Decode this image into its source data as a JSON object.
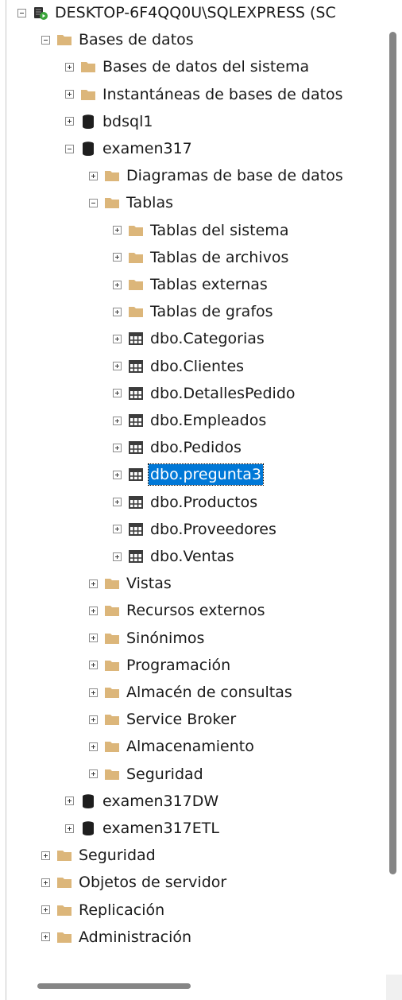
{
  "server": {
    "label": "DESKTOP-6F4QQ0U\\SQLEXPRESS (SC",
    "icon": "server-running-icon",
    "expanded": true
  },
  "tree": [
    {
      "name": "node-bases-de-datos",
      "label": "Bases de datos",
      "level": 1,
      "icon": "folder-icon",
      "expanded": true
    },
    {
      "name": "node-bases-de-datos-del-sistema",
      "label": "Bases de datos del sistema",
      "level": 2,
      "icon": "folder-icon",
      "expanded": false
    },
    {
      "name": "node-instantaneas",
      "label": "Instantáneas de bases de datos",
      "level": 2,
      "icon": "folder-icon",
      "expanded": false
    },
    {
      "name": "node-bdsql1",
      "label": "bdsql1",
      "level": 2,
      "icon": "database-icon",
      "expanded": false
    },
    {
      "name": "node-examen317",
      "label": "examen317",
      "level": 2,
      "icon": "database-icon",
      "expanded": true
    },
    {
      "name": "node-diagramas",
      "label": "Diagramas de base de datos",
      "level": 3,
      "icon": "folder-icon",
      "expanded": false
    },
    {
      "name": "node-tablas",
      "label": "Tablas",
      "level": 3,
      "icon": "folder-icon",
      "expanded": true
    },
    {
      "name": "node-tablas-del-sistema",
      "label": "Tablas del sistema",
      "level": 4,
      "icon": "folder-icon",
      "expanded": false
    },
    {
      "name": "node-tablas-de-archivos",
      "label": "Tablas de archivos",
      "level": 4,
      "icon": "folder-icon",
      "expanded": false
    },
    {
      "name": "node-tablas-externas",
      "label": "Tablas externas",
      "level": 4,
      "icon": "folder-icon",
      "expanded": false
    },
    {
      "name": "node-tablas-de-grafos",
      "label": "Tablas de grafos",
      "level": 4,
      "icon": "folder-icon",
      "expanded": false
    },
    {
      "name": "node-dbo-categorias",
      "label": "dbo.Categorias",
      "level": 4,
      "icon": "table-icon",
      "expanded": false
    },
    {
      "name": "node-dbo-clientes",
      "label": "dbo.Clientes",
      "level": 4,
      "icon": "table-icon",
      "expanded": false
    },
    {
      "name": "node-dbo-detallespedido",
      "label": "dbo.DetallesPedido",
      "level": 4,
      "icon": "table-icon",
      "expanded": false
    },
    {
      "name": "node-dbo-empleados",
      "label": "dbo.Empleados",
      "level": 4,
      "icon": "table-icon",
      "expanded": false
    },
    {
      "name": "node-dbo-pedidos",
      "label": "dbo.Pedidos",
      "level": 4,
      "icon": "table-icon",
      "expanded": false
    },
    {
      "name": "node-dbo-pregunta3",
      "label": "dbo.pregunta3",
      "level": 4,
      "icon": "table-icon",
      "expanded": false,
      "selected": true
    },
    {
      "name": "node-dbo-productos",
      "label": "dbo.Productos",
      "level": 4,
      "icon": "table-icon",
      "expanded": false
    },
    {
      "name": "node-dbo-proveedores",
      "label": "dbo.Proveedores",
      "level": 4,
      "icon": "table-icon",
      "expanded": false
    },
    {
      "name": "node-dbo-ventas",
      "label": "dbo.Ventas",
      "level": 4,
      "icon": "table-icon",
      "expanded": false
    },
    {
      "name": "node-vistas",
      "label": "Vistas",
      "level": 3,
      "icon": "folder-icon",
      "expanded": false
    },
    {
      "name": "node-recursos-externos",
      "label": "Recursos externos",
      "level": 3,
      "icon": "folder-icon",
      "expanded": false
    },
    {
      "name": "node-sinonimos",
      "label": "Sinónimos",
      "level": 3,
      "icon": "folder-icon",
      "expanded": false
    },
    {
      "name": "node-programacion",
      "label": "Programación",
      "level": 3,
      "icon": "folder-icon",
      "expanded": false
    },
    {
      "name": "node-almacen-de-consultas",
      "label": "Almacén de consultas",
      "level": 3,
      "icon": "folder-icon",
      "expanded": false
    },
    {
      "name": "node-service-broker",
      "label": "Service Broker",
      "level": 3,
      "icon": "folder-icon",
      "expanded": false
    },
    {
      "name": "node-almacenamiento",
      "label": "Almacenamiento",
      "level": 3,
      "icon": "folder-icon",
      "expanded": false
    },
    {
      "name": "node-seguridad-db",
      "label": "Seguridad",
      "level": 3,
      "icon": "folder-icon",
      "expanded": false
    },
    {
      "name": "node-examen317dw",
      "label": "examen317DW",
      "level": 2,
      "icon": "database-icon",
      "expanded": false
    },
    {
      "name": "node-examen317etl",
      "label": "examen317ETL",
      "level": 2,
      "icon": "database-icon",
      "expanded": false
    },
    {
      "name": "node-seguridad",
      "label": "Seguridad",
      "level": 1,
      "icon": "folder-icon",
      "expanded": false
    },
    {
      "name": "node-objetos-de-servidor",
      "label": "Objetos de servidor",
      "level": 1,
      "icon": "folder-icon",
      "expanded": false
    },
    {
      "name": "node-replicacion",
      "label": "Replicación",
      "level": 1,
      "icon": "folder-icon",
      "expanded": false
    },
    {
      "name": "node-administracion",
      "label": "Administración",
      "level": 1,
      "icon": "folder-icon",
      "expanded": false
    }
  ],
  "colors": {
    "selection": "#0078d7",
    "folder": "#dcb67a",
    "database": "#1e1e1e",
    "table": "#3c3c3c",
    "server_badge": "#3aa53a"
  }
}
